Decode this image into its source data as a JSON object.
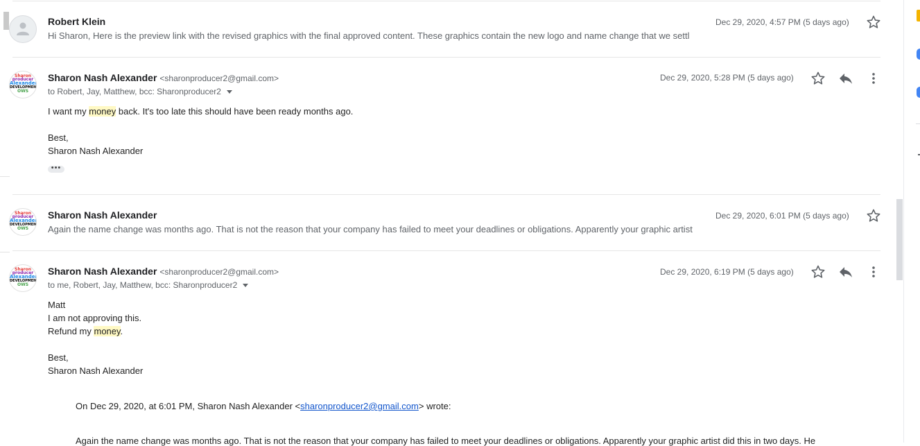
{
  "messages": [
    {
      "sender": "Robert Klein",
      "snippet": "Hi Sharon, Here is the preview link with the revised graphics with the final approved content. These graphics contain the new logo and name change that we settl",
      "date": "Dec 29, 2020, 4:57 PM (5 days ago)",
      "avatar": "default-person-avatar"
    },
    {
      "sender": "Sharon Nash Alexander",
      "email": "<sharonproducer2@gmail.com>",
      "date": "Dec 29, 2020, 5:28 PM (5 days ago)",
      "recipients": "to Robert, Jay, Matthew, bcc: Sharonproducer2",
      "body": {
        "line1_before": "I want my ",
        "line1_highlight": "money",
        "line1_after": " back. It's too late this should have been ready months ago.",
        "signoff": "Best,",
        "signature": "Sharon Nash Alexander"
      },
      "ellipsis": "•••"
    },
    {
      "sender": "Sharon Nash Alexander",
      "snippet": "Again the name change was months ago. That is not the reason that your company has failed to meet your deadlines or obligations. Apparently your graphic artist",
      "date": "Dec 29, 2020, 6:01 PM (5 days ago)"
    },
    {
      "sender": "Sharon Nash Alexander",
      "email": "<sharonproducer2@gmail.com>",
      "date": "Dec 29, 2020, 6:19 PM (5 days ago)",
      "recipients": "to me, Robert, Jay, Matthew, bcc: Sharonproducer2",
      "body": {
        "line1": "Matt",
        "line2": "I am not approving this.",
        "line3_before": "Refund my ",
        "line3_highlight": "money",
        "line3_after": ".",
        "signoff": "Best,",
        "signature": "Sharon Nash Alexander"
      },
      "quote": {
        "intro_before": "On Dec 29, 2020, at 6:01 PM, Sharon Nash Alexander <",
        "intro_link": "sharonproducer2@gmail.com",
        "intro_after": "> wrote:",
        "text": "Again the name change was months ago.   That is not the reason that your company has failed to meet your deadlines or obligations.  Apparently your graphic artist did this in two days.  He"
      }
    }
  ],
  "avatar_logo_words": [
    "Sharon",
    "producer",
    "Alexander",
    "DEVELOPMENT",
    "OWS"
  ],
  "colors": {
    "highlight": "#fff9c4",
    "link": "#1155cc",
    "side_yellow": "#f4b400",
    "side_blue": "#4285f4"
  }
}
